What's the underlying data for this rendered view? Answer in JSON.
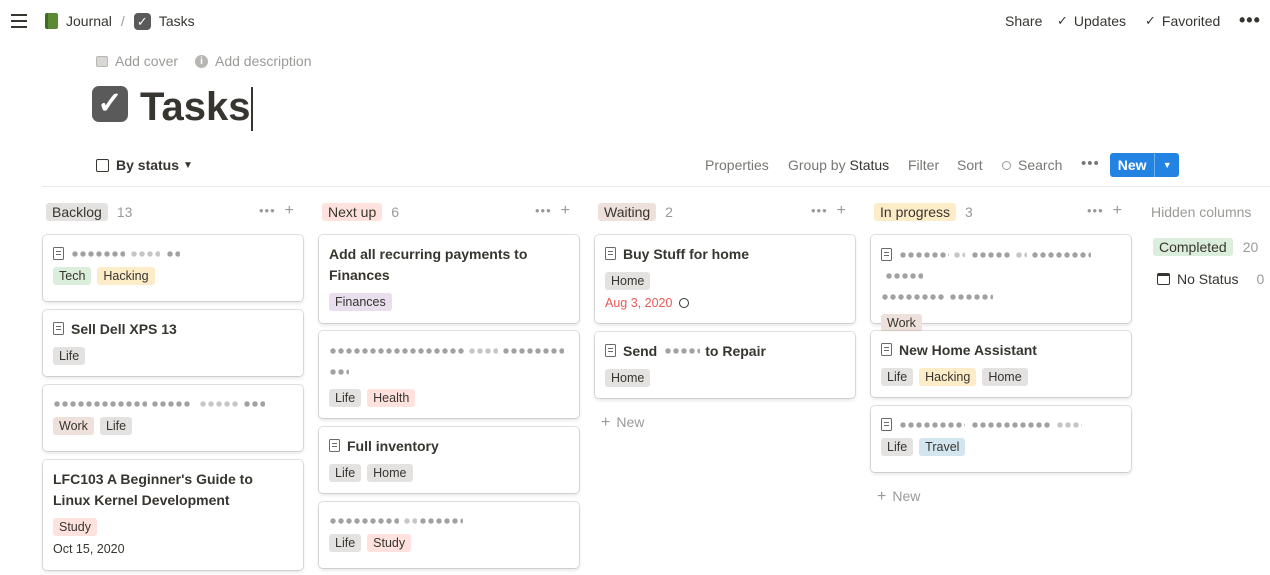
{
  "topbar": {
    "breadcrumb": [
      {
        "label": "Journal"
      },
      {
        "label": "Tasks"
      }
    ],
    "share": "Share",
    "updates": "Updates",
    "favorited": "Favorited"
  },
  "page": {
    "add_cover": "Add cover",
    "add_description": "Add description",
    "title": "Tasks"
  },
  "toolbar": {
    "view": "By status",
    "properties": "Properties",
    "group_by": "Group by",
    "group_by_value": "Status",
    "filter": "Filter",
    "sort": "Sort",
    "search": "Search",
    "new": "New"
  },
  "colors": {
    "tech": "#dbeddb",
    "hacking": "#fdecc8",
    "life": "#e3e2e0",
    "work": "#eee0da",
    "study": "#ffe2dd",
    "finances": "#e8deee",
    "health": "#ffe2dd",
    "home": "#e3e2e0",
    "travel": "#d3e5ef",
    "accent": "#2383e2",
    "date_red": "#eb5757"
  },
  "columns": [
    {
      "label": "Backlog",
      "count": "13"
    },
    {
      "label": "Next up",
      "count": "6"
    },
    {
      "label": "Waiting",
      "count": "2"
    },
    {
      "label": "In progress",
      "count": "3"
    }
  ],
  "hidden": {
    "title": "Hidden columns",
    "completed": "Completed",
    "completed_count": "20",
    "no_status": "No Status",
    "no_status_count": "0"
  },
  "cards": {
    "backlog": [
      {
        "tags": [
          "Tech",
          "Hacking"
        ]
      },
      {
        "title": "Sell Dell XPS 13",
        "tags": [
          "Life"
        ]
      },
      {
        "tags": [
          "Work",
          "Life"
        ]
      },
      {
        "title": "LFC103 A Beginner's Guide to Linux Kernel Development",
        "tags": [
          "Study"
        ],
        "date": "Oct 15, 2020"
      }
    ],
    "nextup": [
      {
        "title": "Add all recurring payments to Finances",
        "tags": [
          "Finances"
        ]
      },
      {
        "tags": [
          "Life",
          "Health"
        ]
      },
      {
        "title": "Full inventory",
        "tags": [
          "Life",
          "Home"
        ]
      },
      {
        "tags": [
          "Life",
          "Study"
        ]
      }
    ],
    "waiting": [
      {
        "title": "Buy Stuff for home",
        "tags": [
          "Home"
        ],
        "date": "Aug 3, 2020"
      },
      {
        "title_start": "Send",
        "title_end": "to Repair",
        "tags": [
          "Home"
        ]
      }
    ],
    "inprogress": [
      {
        "tags": [
          "Work"
        ]
      },
      {
        "title": "New Home Assistant",
        "tags": [
          "Life",
          "Hacking",
          "Home"
        ]
      },
      {
        "tags": [
          "Life",
          "Travel"
        ]
      }
    ]
  },
  "new_label": "New"
}
